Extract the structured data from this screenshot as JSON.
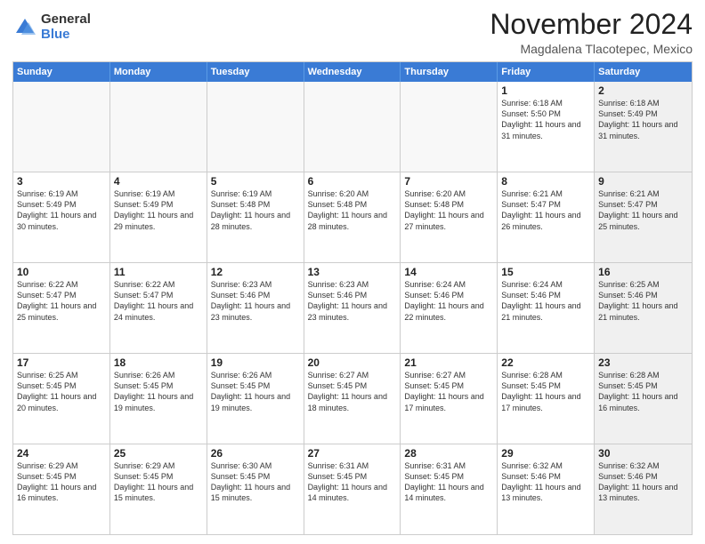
{
  "logo": {
    "general": "General",
    "blue": "Blue"
  },
  "header": {
    "month": "November 2024",
    "location": "Magdalena Tlacotepec, Mexico"
  },
  "weekdays": [
    "Sunday",
    "Monday",
    "Tuesday",
    "Wednesday",
    "Thursday",
    "Friday",
    "Saturday"
  ],
  "rows": [
    [
      {
        "day": "",
        "info": "",
        "shaded": true
      },
      {
        "day": "",
        "info": "",
        "shaded": true
      },
      {
        "day": "",
        "info": "",
        "shaded": true
      },
      {
        "day": "",
        "info": "",
        "shaded": true
      },
      {
        "day": "",
        "info": "",
        "shaded": true
      },
      {
        "day": "1",
        "info": "Sunrise: 6:18 AM\nSunset: 5:50 PM\nDaylight: 11 hours and 31 minutes.",
        "shaded": false
      },
      {
        "day": "2",
        "info": "Sunrise: 6:18 AM\nSunset: 5:49 PM\nDaylight: 11 hours and 31 minutes.",
        "shaded": true
      }
    ],
    [
      {
        "day": "3",
        "info": "Sunrise: 6:19 AM\nSunset: 5:49 PM\nDaylight: 11 hours and 30 minutes.",
        "shaded": false
      },
      {
        "day": "4",
        "info": "Sunrise: 6:19 AM\nSunset: 5:49 PM\nDaylight: 11 hours and 29 minutes.",
        "shaded": false
      },
      {
        "day": "5",
        "info": "Sunrise: 6:19 AM\nSunset: 5:48 PM\nDaylight: 11 hours and 28 minutes.",
        "shaded": false
      },
      {
        "day": "6",
        "info": "Sunrise: 6:20 AM\nSunset: 5:48 PM\nDaylight: 11 hours and 28 minutes.",
        "shaded": false
      },
      {
        "day": "7",
        "info": "Sunrise: 6:20 AM\nSunset: 5:48 PM\nDaylight: 11 hours and 27 minutes.",
        "shaded": false
      },
      {
        "day": "8",
        "info": "Sunrise: 6:21 AM\nSunset: 5:47 PM\nDaylight: 11 hours and 26 minutes.",
        "shaded": false
      },
      {
        "day": "9",
        "info": "Sunrise: 6:21 AM\nSunset: 5:47 PM\nDaylight: 11 hours and 25 minutes.",
        "shaded": true
      }
    ],
    [
      {
        "day": "10",
        "info": "Sunrise: 6:22 AM\nSunset: 5:47 PM\nDaylight: 11 hours and 25 minutes.",
        "shaded": false
      },
      {
        "day": "11",
        "info": "Sunrise: 6:22 AM\nSunset: 5:47 PM\nDaylight: 11 hours and 24 minutes.",
        "shaded": false
      },
      {
        "day": "12",
        "info": "Sunrise: 6:23 AM\nSunset: 5:46 PM\nDaylight: 11 hours and 23 minutes.",
        "shaded": false
      },
      {
        "day": "13",
        "info": "Sunrise: 6:23 AM\nSunset: 5:46 PM\nDaylight: 11 hours and 23 minutes.",
        "shaded": false
      },
      {
        "day": "14",
        "info": "Sunrise: 6:24 AM\nSunset: 5:46 PM\nDaylight: 11 hours and 22 minutes.",
        "shaded": false
      },
      {
        "day": "15",
        "info": "Sunrise: 6:24 AM\nSunset: 5:46 PM\nDaylight: 11 hours and 21 minutes.",
        "shaded": false
      },
      {
        "day": "16",
        "info": "Sunrise: 6:25 AM\nSunset: 5:46 PM\nDaylight: 11 hours and 21 minutes.",
        "shaded": true
      }
    ],
    [
      {
        "day": "17",
        "info": "Sunrise: 6:25 AM\nSunset: 5:45 PM\nDaylight: 11 hours and 20 minutes.",
        "shaded": false
      },
      {
        "day": "18",
        "info": "Sunrise: 6:26 AM\nSunset: 5:45 PM\nDaylight: 11 hours and 19 minutes.",
        "shaded": false
      },
      {
        "day": "19",
        "info": "Sunrise: 6:26 AM\nSunset: 5:45 PM\nDaylight: 11 hours and 19 minutes.",
        "shaded": false
      },
      {
        "day": "20",
        "info": "Sunrise: 6:27 AM\nSunset: 5:45 PM\nDaylight: 11 hours and 18 minutes.",
        "shaded": false
      },
      {
        "day": "21",
        "info": "Sunrise: 6:27 AM\nSunset: 5:45 PM\nDaylight: 11 hours and 17 minutes.",
        "shaded": false
      },
      {
        "day": "22",
        "info": "Sunrise: 6:28 AM\nSunset: 5:45 PM\nDaylight: 11 hours and 17 minutes.",
        "shaded": false
      },
      {
        "day": "23",
        "info": "Sunrise: 6:28 AM\nSunset: 5:45 PM\nDaylight: 11 hours and 16 minutes.",
        "shaded": true
      }
    ],
    [
      {
        "day": "24",
        "info": "Sunrise: 6:29 AM\nSunset: 5:45 PM\nDaylight: 11 hours and 16 minutes.",
        "shaded": false
      },
      {
        "day": "25",
        "info": "Sunrise: 6:29 AM\nSunset: 5:45 PM\nDaylight: 11 hours and 15 minutes.",
        "shaded": false
      },
      {
        "day": "26",
        "info": "Sunrise: 6:30 AM\nSunset: 5:45 PM\nDaylight: 11 hours and 15 minutes.",
        "shaded": false
      },
      {
        "day": "27",
        "info": "Sunrise: 6:31 AM\nSunset: 5:45 PM\nDaylight: 11 hours and 14 minutes.",
        "shaded": false
      },
      {
        "day": "28",
        "info": "Sunrise: 6:31 AM\nSunset: 5:45 PM\nDaylight: 11 hours and 14 minutes.",
        "shaded": false
      },
      {
        "day": "29",
        "info": "Sunrise: 6:32 AM\nSunset: 5:46 PM\nDaylight: 11 hours and 13 minutes.",
        "shaded": false
      },
      {
        "day": "30",
        "info": "Sunrise: 6:32 AM\nSunset: 5:46 PM\nDaylight: 11 hours and 13 minutes.",
        "shaded": true
      }
    ]
  ]
}
